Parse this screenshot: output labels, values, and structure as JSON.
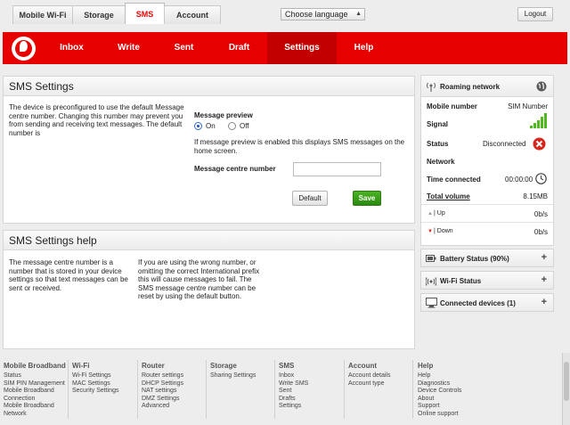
{
  "top_tabs": [
    "Mobile Wi-Fi",
    "Storage",
    "SMS",
    "Account"
  ],
  "language_select": "Choose language",
  "logout_label": "Logout",
  "nav": [
    "Inbox",
    "Write",
    "Sent",
    "Draft",
    "Settings",
    "Help"
  ],
  "sms_settings": {
    "title": "SMS Settings",
    "description": "The device is preconfigured to use the default Message centre number. Changing this number may prevent you from sending and receiving text messages. The default number is",
    "preview_label": "Message preview",
    "on_label": "On",
    "off_label": "Off",
    "preview_selected": "On",
    "preview_note": "If message preview is enabled this displays SMS messages on the home screen.",
    "centre_label": "Message centre number",
    "centre_value": "",
    "default_button": "Default",
    "save_button": "Save"
  },
  "sms_help": {
    "title": "SMS Settings help",
    "col1": "The message centre number is a number that is stored in your device settings so that text messages can be sent or received.",
    "col2": "If you are using the wrong number, or omitting the correct International prefix this will cause messages to fail. The SMS message centre number can be reset by using the default button."
  },
  "roaming": {
    "title": "Roaming network",
    "mobile_number_label": "Mobile number",
    "mobile_number_value": "SIM Number",
    "signal_label": "Signal",
    "status_label": "Status",
    "status_value": "Disconnected",
    "network_label": "Network",
    "time_label": "Time connected",
    "time_value": "00:00:00",
    "volume_label": "Total volume",
    "volume_value": "8.15MB",
    "up_label": "Up",
    "up_value": "0b/s",
    "down_label": "Down",
    "down_value": "0b/s"
  },
  "side_boxes": [
    "Battery Status (90%)",
    "Wi-Fi Status",
    "Connected devices (1)"
  ],
  "footer": [
    {
      "head": "Mobile Broadband",
      "links": [
        "Status",
        "SIM PIN Management",
        "Mobile Broadband",
        "Connection",
        "Mobile Broadband",
        "Network"
      ]
    },
    {
      "head": "Wi-Fi",
      "links": [
        "Wi-Fi Settings",
        "MAC Settings",
        "Security Settings"
      ]
    },
    {
      "head": "Router",
      "links": [
        "Router settings",
        "DHCP Settings",
        "NAT settings",
        "DMZ Settings",
        "Advanced"
      ]
    },
    {
      "head": "Storage",
      "links": [
        "Sharing Settings"
      ]
    },
    {
      "head": "SMS",
      "links": [
        "Inbox",
        "Write SMS",
        "Sent",
        "Drafts",
        "Settings"
      ]
    },
    {
      "head": "Account",
      "links": [
        "Account details",
        "Account type"
      ]
    },
    {
      "head": "Help",
      "links": [
        "Help",
        "Diagnostics",
        "Device Controls",
        "About",
        "Support",
        "Online support"
      ]
    }
  ],
  "colors": {
    "brand_red": "#e60000",
    "save_green": "#2b8a10",
    "error_red": "#d9261c"
  }
}
